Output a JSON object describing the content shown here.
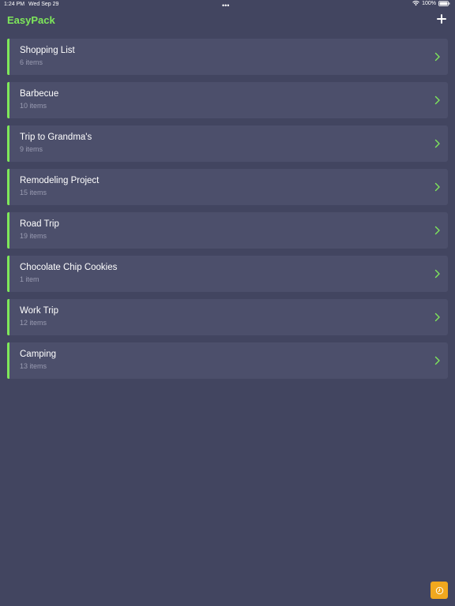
{
  "status_bar": {
    "time": "1:24 PM",
    "date": "Wed Sep 29",
    "dots": "•••",
    "battery": "100%"
  },
  "header": {
    "title": "EasyPack",
    "add_icon": "plus-icon"
  },
  "colors": {
    "background": "#424560",
    "card": "#4c4f6b",
    "accent": "#7ee85a",
    "muted_text": "#9a9cb2",
    "history_button": "#f1a81e"
  },
  "lists": [
    {
      "title": "Shopping List",
      "count": "6 items"
    },
    {
      "title": "Barbecue",
      "count": "10 items"
    },
    {
      "title": "Trip to Grandma's",
      "count": "9 items"
    },
    {
      "title": "Remodeling Project",
      "count": "15 items"
    },
    {
      "title": "Road Trip",
      "count": "19 items"
    },
    {
      "title": "Chocolate Chip Cookies",
      "count": "1 item"
    },
    {
      "title": "Work Trip",
      "count": "12 items"
    },
    {
      "title": "Camping",
      "count": "13 items"
    }
  ],
  "history_button": {
    "icon": "clock-icon"
  }
}
